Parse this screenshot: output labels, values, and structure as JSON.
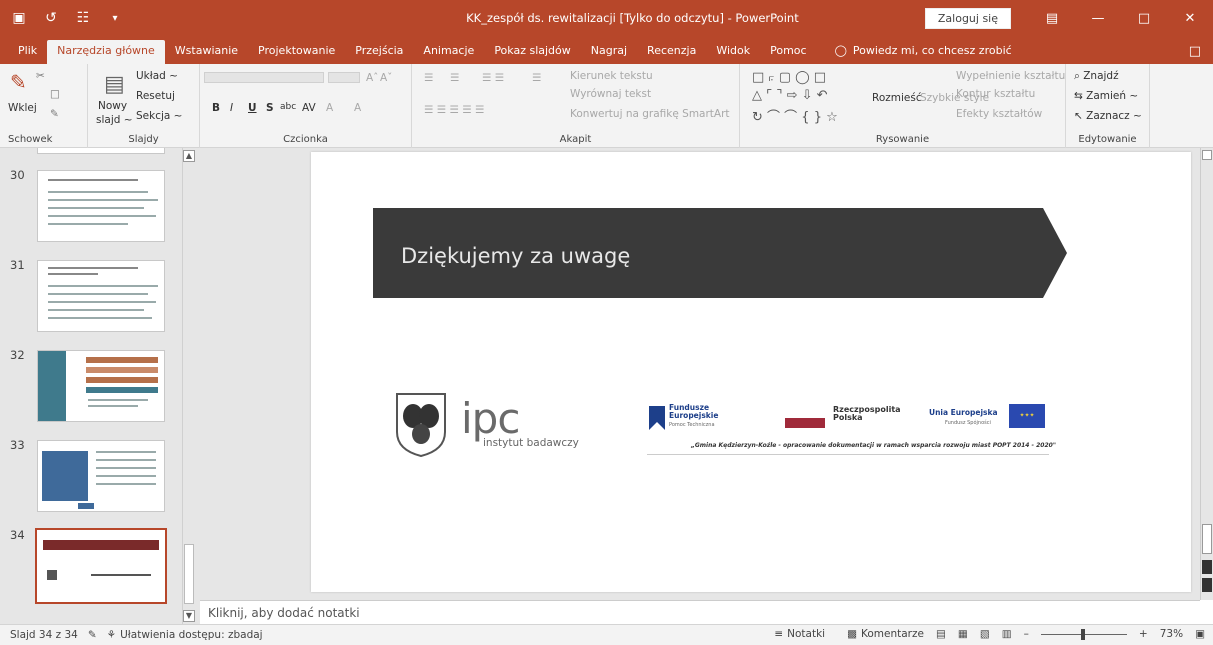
{
  "titlebar": {
    "title": "KK_zespół ds. rewitalizacji [Tylko do odczytu]  -  PowerPoint",
    "login": "Zaloguj się",
    "icons": [
      "save-icon",
      "undo-icon",
      "start-presentation-icon",
      "customize-icon"
    ]
  },
  "menu": {
    "tabs": [
      "Plik",
      "Narzędzia główne",
      "Wstawianie",
      "Projektowanie",
      "Przejścia",
      "Animacje",
      "Pokaz slajdów",
      "Nagraj",
      "Recenzja",
      "Widok",
      "Pomoc"
    ],
    "tell_me": "Powiedz mi, co chcesz zrobić"
  },
  "ribbon": {
    "clipboard": {
      "paste": "Wklej",
      "label": "Schowek"
    },
    "slides": {
      "new": "Nowy",
      "new2": "slajd ~",
      "layout": "Układ ~",
      "reset": "Resetuj",
      "section": "Sekcja ~",
      "label": "Slajdy"
    },
    "font": {
      "bold": "B",
      "italic": "I",
      "underline": "U",
      "strike": "S",
      "abc": "abc",
      "av": "AV",
      "a1": "A",
      "a2": "A",
      "label": "Czcionka"
    },
    "paragraph": {
      "direction": "Kierunek tekstu",
      "align": "Wyrównaj tekst",
      "smartart": "Konwertuj na grafikę SmartArt",
      "label": "Akapit"
    },
    "drawing": {
      "arrange": "Rozmieść",
      "styles": "Szybkie style",
      "fill": "Wypełnienie kształtu",
      "outline": "Kontur kształtu",
      "effects": "Efekty kształtów",
      "label": "Rysowanie"
    },
    "editing": {
      "find": "Znajdź",
      "replace": "Zamień ~",
      "select": "Zaznacz ~",
      "label": "Edytowanie"
    }
  },
  "thumbnails": [
    {
      "num": "30"
    },
    {
      "num": "31"
    },
    {
      "num": "32"
    },
    {
      "num": "33"
    },
    {
      "num": "34"
    }
  ],
  "slide": {
    "banner_text": "Dziękujemy za uwagę",
    "ipc": "ipc",
    "ipc_sub": "instytut badawczy",
    "eu_fe": "Fundusze Europejskie",
    "eu_fe_sub": "Pomoc Techniczna",
    "eu_rp": "Rzeczpospolita Polska",
    "eu_ue": "Unia Europejska",
    "eu_ue_sub": "Fundusz Spójności",
    "eu_caption": "„Gmina Kędzierzyn-Koźle - opracowanie dokumentacji w ramach wsparcia rozwoju miast POPT 2014 - 2020\""
  },
  "notes": {
    "placeholder": "Kliknij, aby dodać notatki"
  },
  "statusbar": {
    "slide": "Slajd 34 z 34",
    "accessibility": "Ułatwienia dostępu: zbadaj",
    "notes": "Notatki",
    "comments": "Komentarze",
    "zoom": "73%"
  },
  "colors": {
    "accent": "#b7472a",
    "banner": "#3a3a3a"
  }
}
